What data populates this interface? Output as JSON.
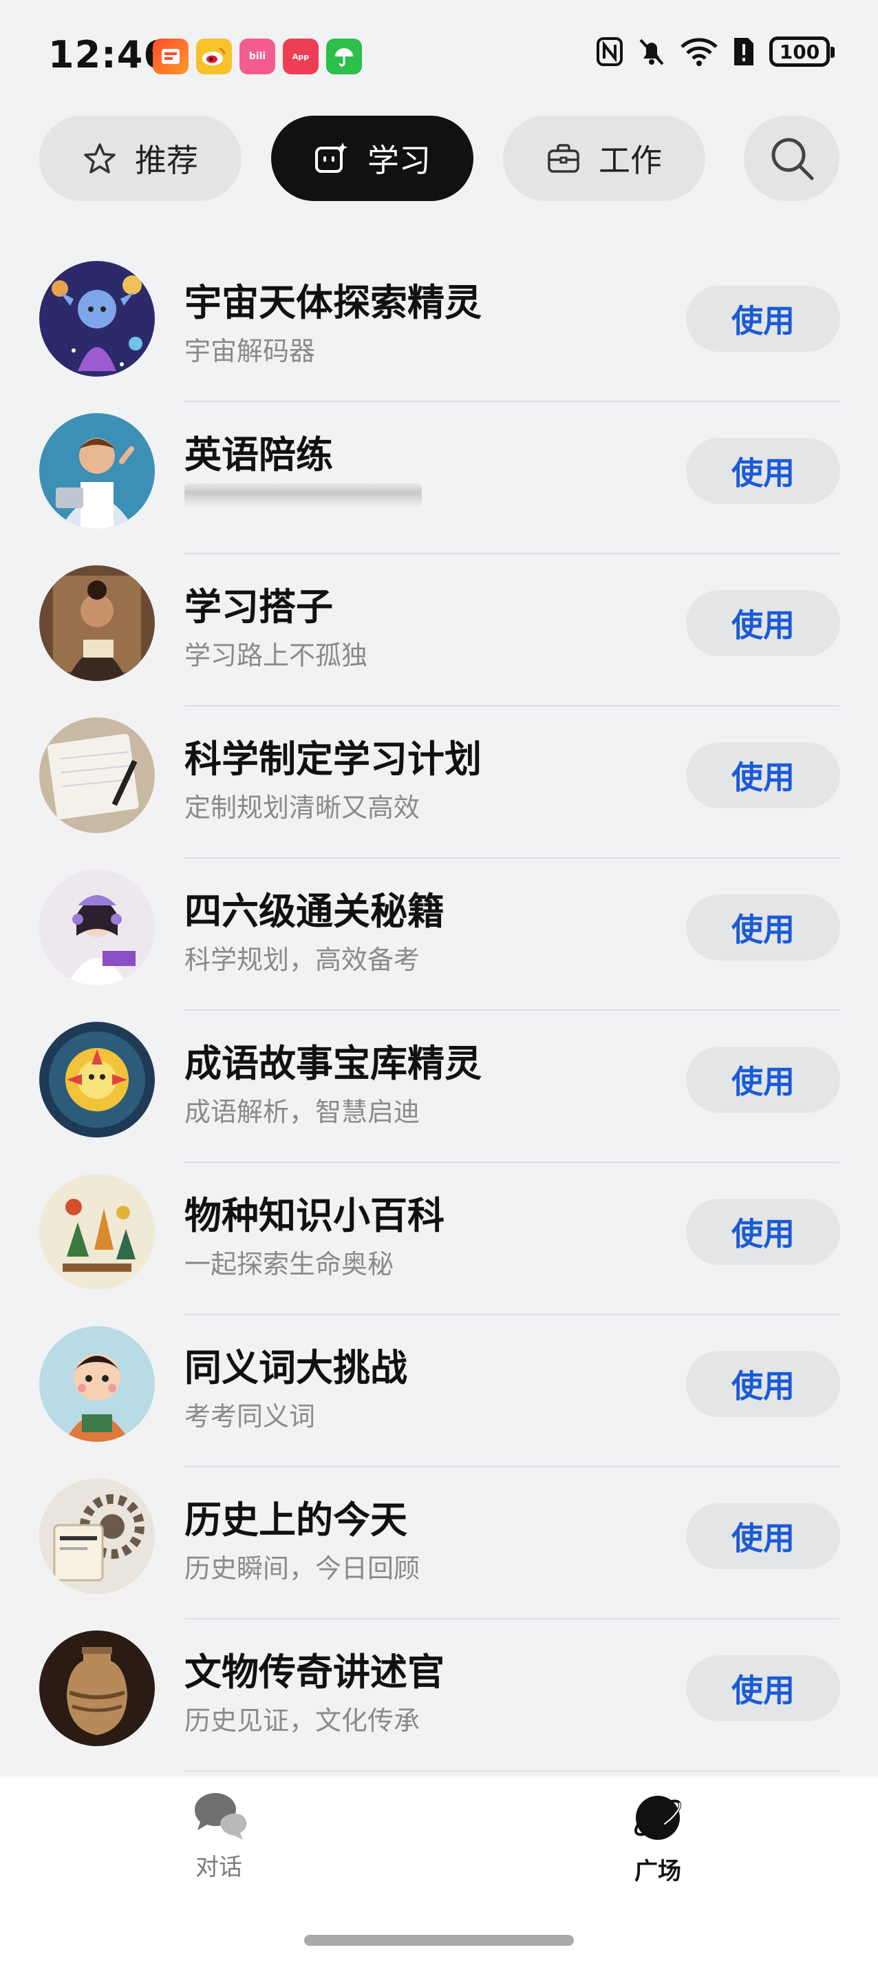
{
  "status_bar": {
    "time": "12:46",
    "battery": "100",
    "notification_apps": [
      "taobao-icon",
      "weibo-icon",
      "bilibili-icon",
      "app-gallery-icon",
      "umbrella-icon"
    ],
    "app_labels": {
      "bilibili": "bili",
      "gallery": "App"
    }
  },
  "tabs": [
    {
      "label": "推荐",
      "icon": "star-icon",
      "active": false
    },
    {
      "label": "学习",
      "icon": "ai-chat-icon",
      "active": true
    },
    {
      "label": "工作",
      "icon": "briefcase-icon",
      "active": false
    }
  ],
  "use_label": "使用",
  "items": [
    {
      "title": "宇宙天体探索精灵",
      "subtitle": "宇宙解码器",
      "avatar": "space-fairy"
    },
    {
      "title": "英语陪练",
      "subtitle": "",
      "avatar": "english-tutor"
    },
    {
      "title": "学习搭子",
      "subtitle": "学习路上不孤独",
      "avatar": "study-buddy"
    },
    {
      "title": "科学制定学习计划",
      "subtitle": "定制规划清晰又高效",
      "avatar": "planner"
    },
    {
      "title": "四六级通关秘籍",
      "subtitle": "科学规划，高效备考",
      "avatar": "exam-girl"
    },
    {
      "title": "成语故事宝库精灵",
      "subtitle": "成语解析，智慧启迪",
      "avatar": "dragon"
    },
    {
      "title": "物种知识小百科",
      "subtitle": "一起探索生命奥秘",
      "avatar": "species"
    },
    {
      "title": "同义词大挑战",
      "subtitle": "考考同义词",
      "avatar": "boy"
    },
    {
      "title": "历史上的今天",
      "subtitle": "历史瞬间，今日回顾",
      "avatar": "history-gear"
    },
    {
      "title": "文物传奇讲述官",
      "subtitle": "历史见证，文化传承",
      "avatar": "vase"
    }
  ],
  "bottom_nav": [
    {
      "label": "对话",
      "icon": "chat-bubbles-icon",
      "active": false
    },
    {
      "label": "广场",
      "icon": "planet-icon",
      "active": true
    }
  ]
}
